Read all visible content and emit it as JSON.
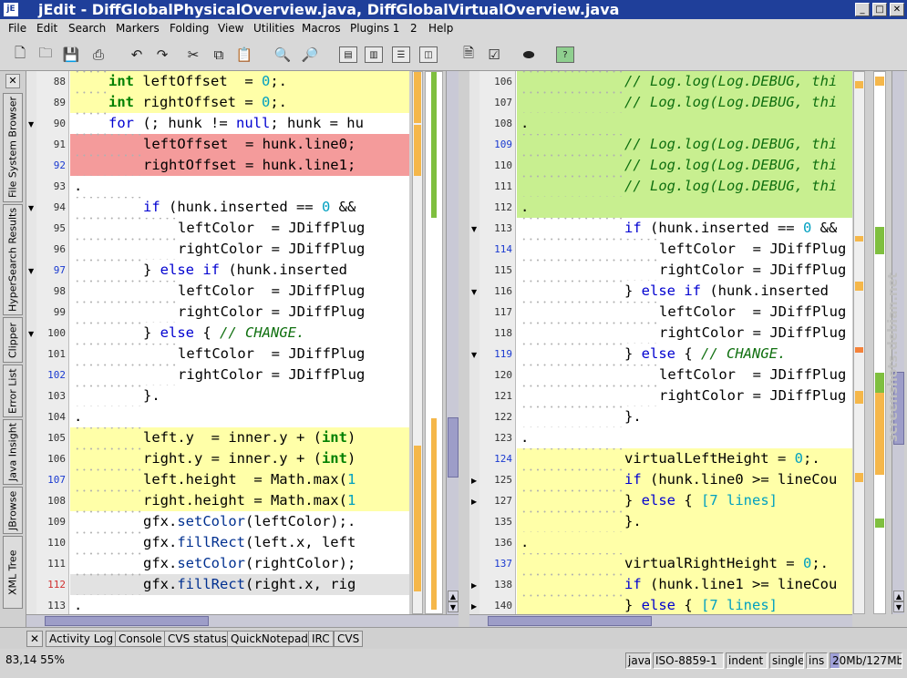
{
  "window": {
    "title": "jEdit - DiffGlobalPhysicalOverview.java, DiffGlobalVirtualOverview.java",
    "icon_text": "jE",
    "buttons": {
      "minimize": "_",
      "maximize": "□",
      "close": "✕"
    }
  },
  "menu": [
    "File",
    "Edit",
    "Search",
    "Markers",
    "Folding",
    "View",
    "Utilities",
    "Macros",
    "Plugins 1",
    "2",
    "Help"
  ],
  "toolbar": {
    "icons": [
      "new-file-icon",
      "open-file-icon",
      "save-icon",
      "print-icon",
      "undo-icon",
      "redo-icon",
      "cut-icon",
      "copy-icon",
      "paste-icon",
      "find-icon",
      "find-next-icon",
      "split-horizontal-icon",
      "split-vertical-icon",
      "unsplit-icon",
      "split-pane-icon",
      "buffer-options-icon",
      "global-options-icon",
      "plugin-icon",
      "help-icon"
    ],
    "help_label": "?"
  },
  "left_dock": {
    "close_label": "✕",
    "tabs": [
      "File System Browser",
      "HyperSearch Results",
      "Clipper",
      "Error List",
      "Java Insight",
      "JBrowse",
      "XML Tree"
    ]
  },
  "left_pane": {
    "lines": [
      {
        "num": "88",
        "code": "int leftOffset  = 0;.",
        "bg": "y",
        "indent": 1,
        "kind": "decl"
      },
      {
        "num": "89",
        "code": "int rightOffset = 0;.",
        "bg": "y",
        "indent": 1,
        "kind": "decl"
      },
      {
        "num": "90",
        "code": "for (; hunk != null; hunk = hu",
        "bg": "",
        "indent": 1,
        "fold": "▼",
        "kind": "for"
      },
      {
        "num": "91",
        "code": "leftOffset  = hunk.line0;",
        "bg": "r",
        "indent": 2
      },
      {
        "num": "92",
        "code": "rightOffset = hunk.line1;",
        "bg": "r",
        "indent": 2,
        "numcolor": "#1a3ad0"
      },
      {
        "num": "93",
        "code": ".",
        "bg": "",
        "indent": 0
      },
      {
        "num": "94",
        "code": "if (hunk.inserted == 0 &&",
        "bg": "",
        "indent": 2,
        "fold": "▼",
        "kind": "if"
      },
      {
        "num": "95",
        "code": "leftColor  = JDiffPlug",
        "bg": "",
        "indent": 3
      },
      {
        "num": "96",
        "code": "rightColor = JDiffPlug",
        "bg": "",
        "indent": 3
      },
      {
        "num": "97",
        "code": "} else if (hunk.inserted",
        "bg": "",
        "indent": 2,
        "fold": "▼",
        "numcolor": "#1a3ad0",
        "kind": "elseif"
      },
      {
        "num": "98",
        "code": "leftColor  = JDiffPlug",
        "bg": "",
        "indent": 3
      },
      {
        "num": "99",
        "code": "rightColor = JDiffPlug",
        "bg": "",
        "indent": 3
      },
      {
        "num": "100",
        "code": "} else { // CHANGE.",
        "bg": "",
        "indent": 2,
        "fold": "▼",
        "kind": "else"
      },
      {
        "num": "101",
        "code": "leftColor  = JDiffPlug",
        "bg": "",
        "indent": 3
      },
      {
        "num": "102",
        "code": "rightColor = JDiffPlug",
        "bg": "",
        "indent": 3,
        "numcolor": "#1a3ad0"
      },
      {
        "num": "103",
        "code": "}.",
        "bg": "",
        "indent": 2
      },
      {
        "num": "104",
        "code": ".",
        "bg": "",
        "indent": 0
      },
      {
        "num": "105",
        "code": "left.y  = inner.y + (int)",
        "bg": "y",
        "indent": 2,
        "kind": "cast"
      },
      {
        "num": "106",
        "code": "right.y = inner.y + (int)",
        "bg": "y",
        "indent": 2,
        "kind": "cast"
      },
      {
        "num": "107",
        "code": "left.height  = Math.max(1",
        "bg": "y",
        "indent": 2,
        "numcolor": "#1a3ad0"
      },
      {
        "num": "108",
        "code": "right.height = Math.max(1",
        "bg": "y",
        "indent": 2
      },
      {
        "num": "109",
        "code": "gfx.setColor(leftColor);.",
        "bg": "",
        "indent": 2
      },
      {
        "num": "110",
        "code": "gfx.fillRect(left.x, left",
        "bg": "",
        "indent": 2
      },
      {
        "num": "111",
        "code": "gfx.setColor(rightColor);",
        "bg": "",
        "indent": 2
      },
      {
        "num": "112",
        "code": "gfx.fillRect(right.x, rig",
        "bg": "grey",
        "indent": 2,
        "numcolor": "#d03030"
      },
      {
        "num": "113",
        "code": ".",
        "bg": "",
        "indent": 0
      }
    ]
  },
  "right_pane": {
    "lines": [
      {
        "num": "106",
        "code": "// Log.log(Log.DEBUG, thi",
        "bg": "g",
        "indent": 3,
        "kind": "comment"
      },
      {
        "num": "107",
        "code": "// Log.log(Log.DEBUG, thi",
        "bg": "g",
        "indent": 3,
        "kind": "comment"
      },
      {
        "num": "108",
        "code": ".",
        "bg": "g",
        "indent": 0
      },
      {
        "num": "109",
        "code": "// Log.log(Log.DEBUG, thi",
        "bg": "g",
        "indent": 3,
        "kind": "comment",
        "numcolor": "#1a3ad0"
      },
      {
        "num": "110",
        "code": "// Log.log(Log.DEBUG, thi",
        "bg": "g",
        "indent": 3,
        "kind": "comment"
      },
      {
        "num": "111",
        "code": "// Log.log(Log.DEBUG, thi",
        "bg": "g",
        "indent": 3,
        "kind": "comment"
      },
      {
        "num": "112",
        "code": ".",
        "bg": "g",
        "indent": 0
      },
      {
        "num": "113",
        "code": "if (hunk.inserted == 0 &&",
        "bg": "",
        "indent": 3,
        "fold": "▼",
        "kind": "if"
      },
      {
        "num": "114",
        "code": "leftColor  = JDiffPlug",
        "bg": "",
        "indent": 4,
        "numcolor": "#1a3ad0"
      },
      {
        "num": "115",
        "code": "rightColor = JDiffPlug",
        "bg": "",
        "indent": 4
      },
      {
        "num": "116",
        "code": "} else if (hunk.inserted",
        "bg": "",
        "indent": 3,
        "fold": "▼",
        "kind": "elseif"
      },
      {
        "num": "117",
        "code": "leftColor  = JDiffPlug",
        "bg": "",
        "indent": 4
      },
      {
        "num": "118",
        "code": "rightColor = JDiffPlug",
        "bg": "",
        "indent": 4
      },
      {
        "num": "119",
        "code": "} else { // CHANGE.",
        "bg": "",
        "indent": 3,
        "fold": "▼",
        "kind": "else",
        "numcolor": "#1a3ad0"
      },
      {
        "num": "120",
        "code": "leftColor  = JDiffPlug",
        "bg": "",
        "indent": 4
      },
      {
        "num": "121",
        "code": "rightColor = JDiffPlug",
        "bg": "",
        "indent": 4
      },
      {
        "num": "122",
        "code": "}.",
        "bg": "",
        "indent": 3
      },
      {
        "num": "123",
        "code": ".",
        "bg": "",
        "indent": 0
      },
      {
        "num": "124",
        "code": "virtualLeftHeight = 0;.",
        "bg": "y",
        "indent": 3,
        "numcolor": "#1a3ad0"
      },
      {
        "num": "125",
        "code": "if (hunk.line0 >= lineCou",
        "bg": "y",
        "indent": 3,
        "fold": "▶",
        "kind": "if"
      },
      {
        "num": "127",
        "code": "} else { [7 lines]",
        "bg": "y",
        "indent": 3,
        "fold": "▶",
        "kind": "elsefold"
      },
      {
        "num": "135",
        "code": "}.",
        "bg": "y",
        "indent": 3
      },
      {
        "num": "136",
        "code": ".",
        "bg": "y",
        "indent": 0
      },
      {
        "num": "137",
        "code": "virtualRightHeight = 0;.",
        "bg": "y",
        "indent": 3,
        "numcolor": "#1a3ad0"
      },
      {
        "num": "138",
        "code": "if (hunk.line1 >= lineCou",
        "bg": "y",
        "indent": 3,
        "fold": "▶",
        "kind": "if"
      },
      {
        "num": "140",
        "code": "} else { [7 lines]",
        "bg": "y",
        "indent": 3,
        "fold": "▶",
        "kind": "elsefold"
      }
    ]
  },
  "bottom_tabs": {
    "close_label": "✕",
    "tabs": [
      "Activity Log",
      "Console",
      "CVS status",
      "QuickNotepad",
      "IRC",
      "CVS"
    ]
  },
  "status": {
    "position": "83,14 55%",
    "mode": "java",
    "encoding": "ISO-8859-1",
    "indent": "indent",
    "selection": "single",
    "insert": "ins",
    "memory": "20Mb/127Mb"
  },
  "watermark": "screenshots.debian.net",
  "colors": {
    "added": "#ffffa8",
    "deleted": "#f49b9b",
    "changed": "#c8ef90",
    "keyword": "#0000d0",
    "comment": "#107010"
  }
}
